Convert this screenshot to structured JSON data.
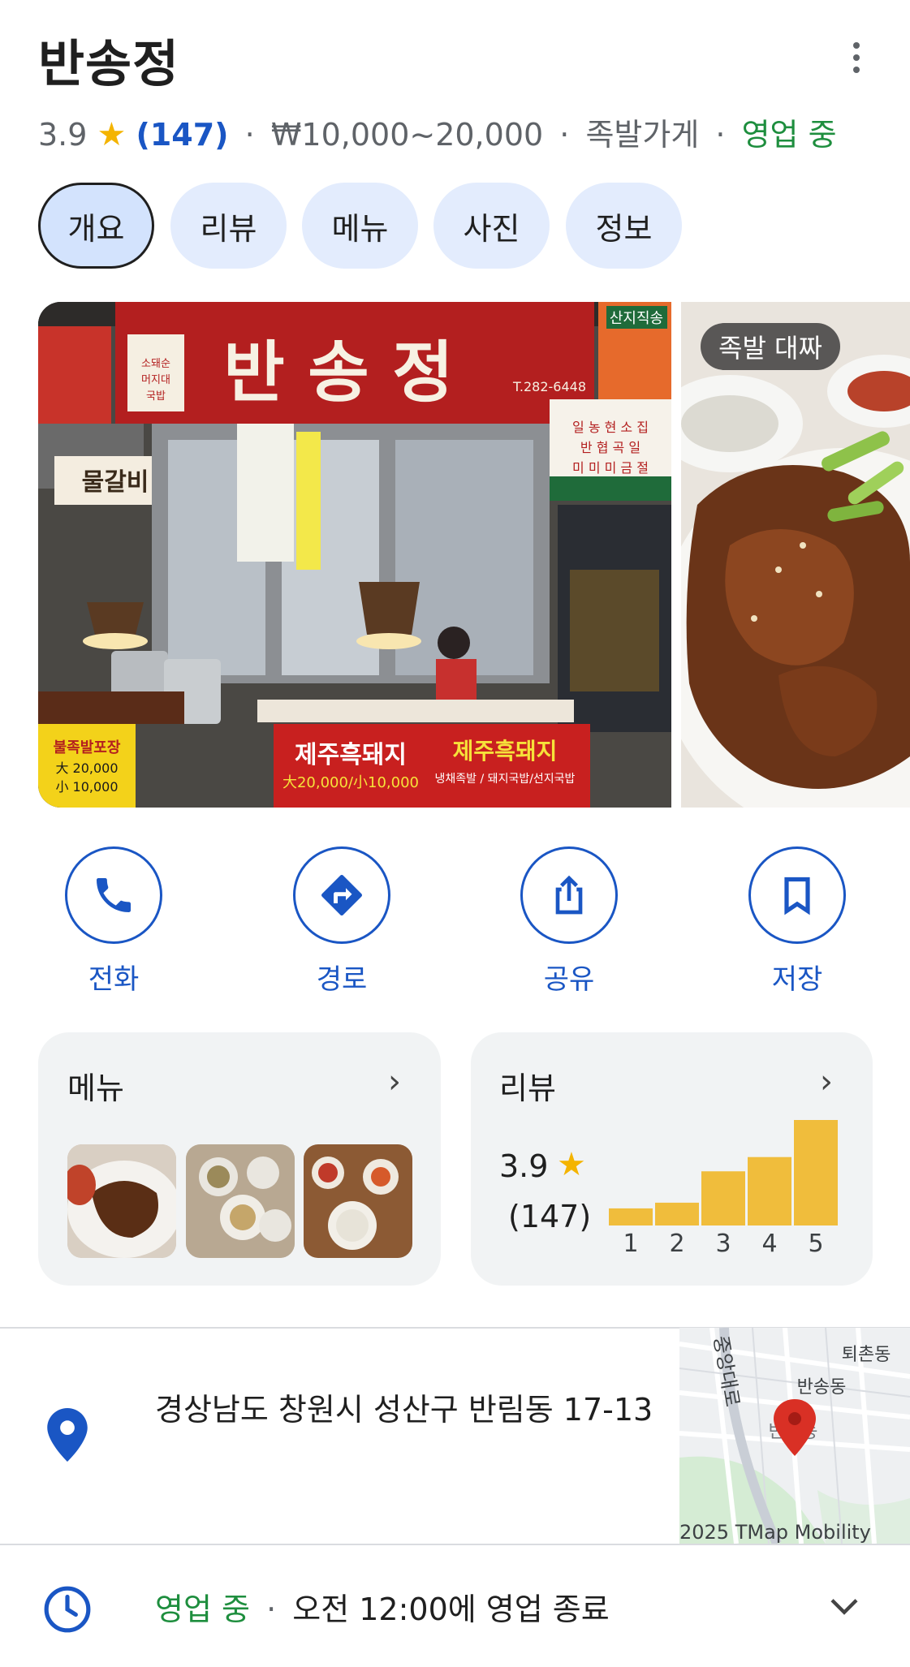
{
  "header": {
    "title": "반송정",
    "rating": "3.9",
    "star": "★",
    "review_count": "(147)",
    "price": "₩10,000~20,000",
    "category": "족발가게",
    "status": "영업 중",
    "separator": "·"
  },
  "tabs": [
    {
      "label": "개요",
      "active": true
    },
    {
      "label": "리뷰",
      "active": false
    },
    {
      "label": "메뉴",
      "active": false
    },
    {
      "label": "사진",
      "active": false
    },
    {
      "label": "정보",
      "active": false
    }
  ],
  "photos": {
    "storefront": {
      "sign_name": "반 송 정",
      "sign_phone": "T.282-6448",
      "sign_side": "소머리국밥 / 돼지국밥 / 순대국밥",
      "banner_left": "제주흑돼지",
      "banner_right": "제주흑돼지",
      "banner_price": "大20,000/小10,000",
      "banner_sub": "냉채족발 / 돼지국밥/선지국밥",
      "right_sign": "산지직송",
      "left_sign": "물갈비"
    },
    "side_badge": "족발 대짜"
  },
  "actions": [
    {
      "label": "전화",
      "icon": "phone-icon"
    },
    {
      "label": "경로",
      "icon": "directions-icon"
    },
    {
      "label": "공유",
      "icon": "share-icon"
    },
    {
      "label": "저장",
      "icon": "bookmark-icon"
    }
  ],
  "menu_card": {
    "title": "메뉴",
    "chevron": "›"
  },
  "review_card": {
    "title": "리뷰",
    "chevron": "›",
    "rating": "3.9",
    "star": "★",
    "count": "(147)"
  },
  "chart_data": {
    "type": "bar",
    "categories": [
      "1",
      "2",
      "3",
      "4",
      "5"
    ],
    "values": [
      6,
      8,
      19,
      24,
      37
    ],
    "xlabel": "",
    "ylabel": "",
    "bar_color": "#f0bd3c"
  },
  "address": {
    "text": "경상남도 창원시 성산구 반림동 17-13",
    "map_labels": [
      "퇴촌동",
      "반송동",
      "중앙대로",
      "반송동"
    ],
    "map_credit": "2025 TMap Mobility"
  },
  "hours": {
    "status": "영업 중",
    "separator": "·",
    "detail": "오전 12:00에 영업 종료"
  },
  "colors": {
    "accent": "#1a56c4",
    "open_green": "#1e8e3e",
    "star_yellow": "#f4b400",
    "tab_bg": "#e3ecfd",
    "card_bg": "#f1f3f4"
  }
}
